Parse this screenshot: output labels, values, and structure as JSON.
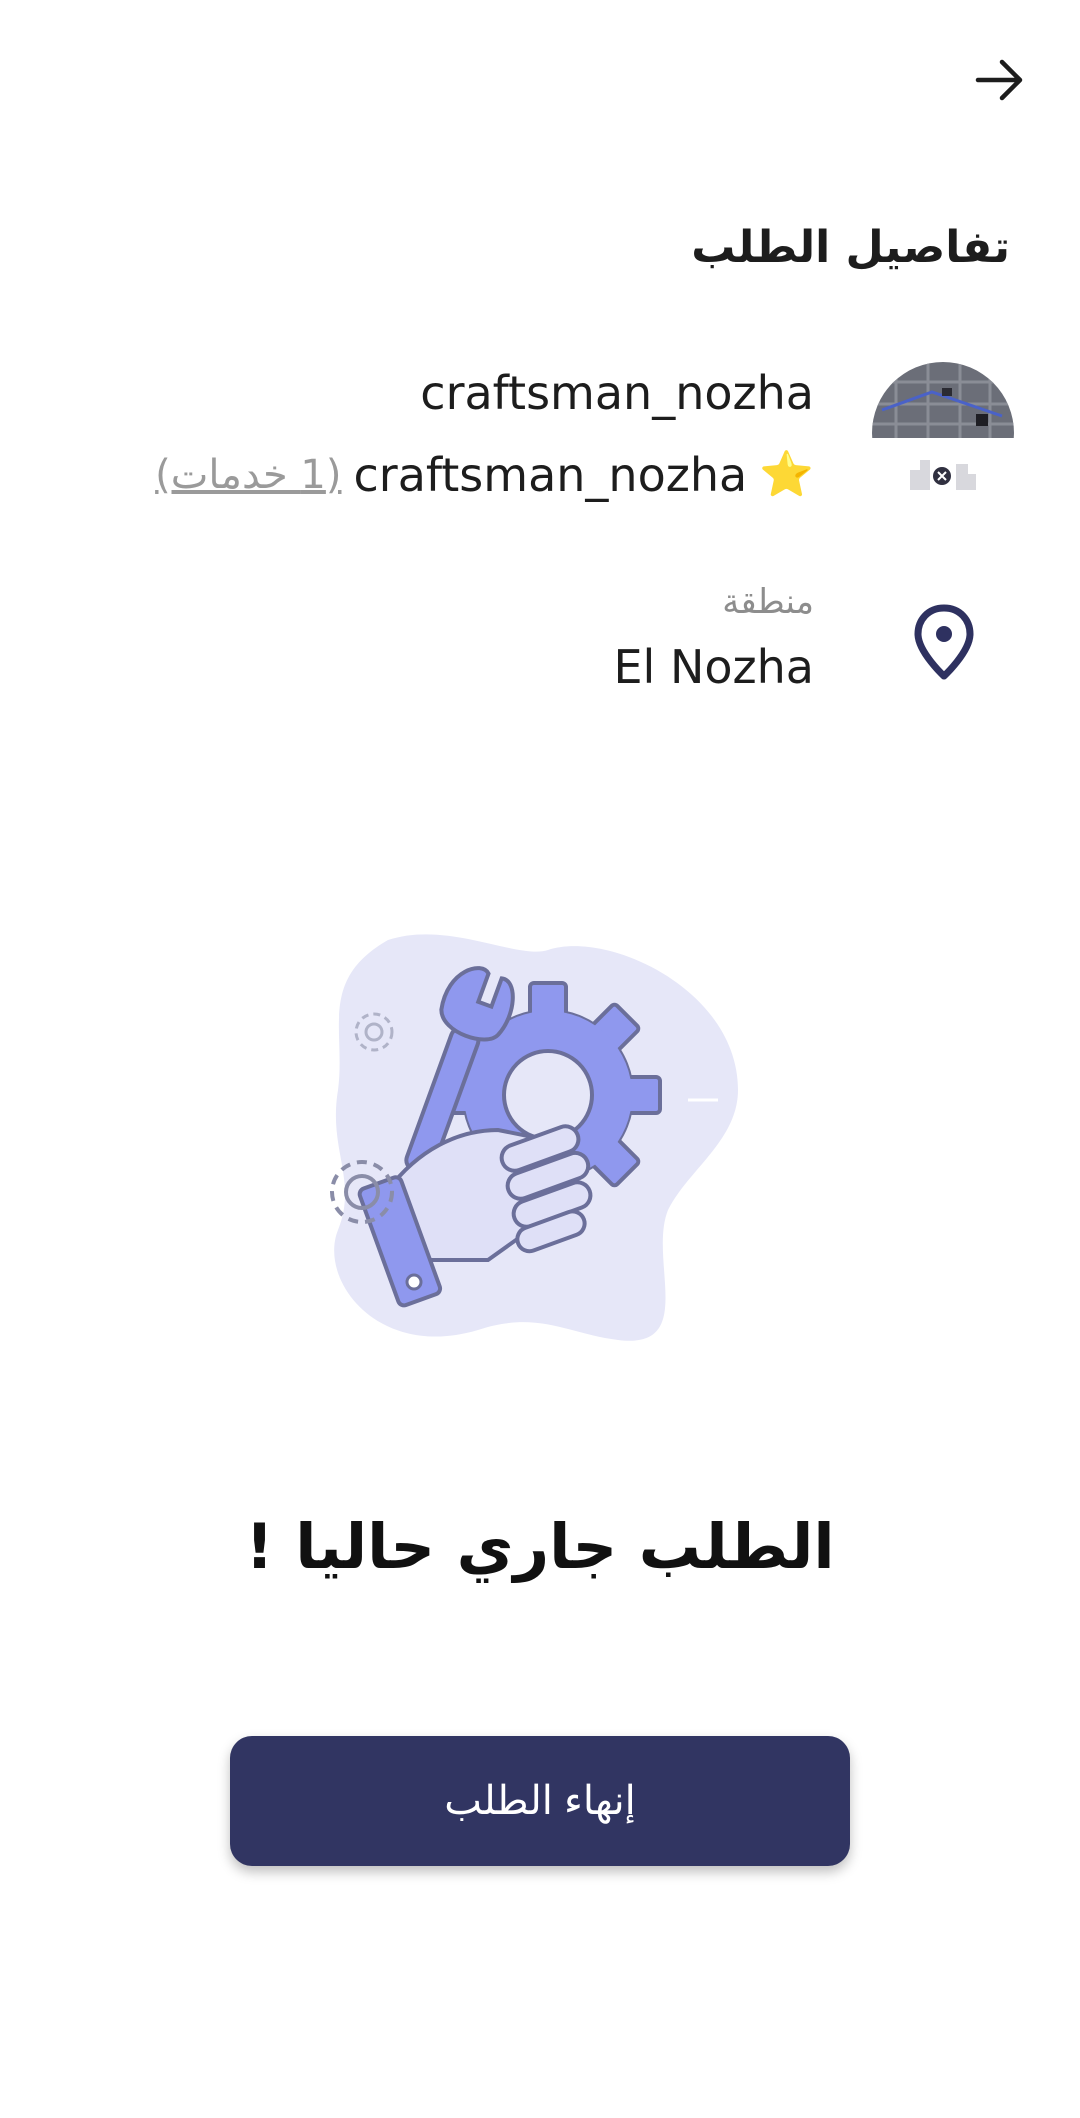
{
  "header": {
    "back_icon": "arrow-right-icon",
    "title": "تفاصيل الطلب"
  },
  "provider": {
    "name": "craftsman_nozha",
    "rating_icon": "star-icon",
    "star_glyph": "⭐",
    "sub_name": "craftsman_nozha",
    "services_count": "(1 خدمات)"
  },
  "location": {
    "icon": "location-pin-icon",
    "label": "منطقة",
    "value": "El Nozha"
  },
  "status": {
    "illustration": "hand-wrench-gear-illustration",
    "message": "الطلب جاري حاليا !"
  },
  "actions": {
    "finish_label": "إنهاء الطلب"
  },
  "colors": {
    "primary": "#313562",
    "star": "#ffd83b",
    "illustration_main": "#8f98ee",
    "illustration_bg": "#e6e7f8"
  }
}
